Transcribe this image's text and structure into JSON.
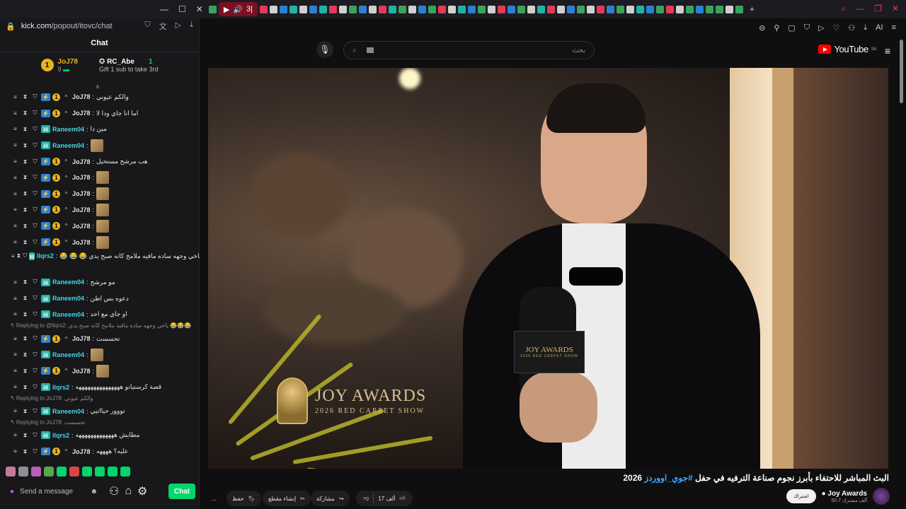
{
  "browser": {
    "audio_tab_count": "3|",
    "colors": {
      "accent": "#7a0f21",
      "chat_green": "#00d66b",
      "gold": "#e6b31e",
      "yt_red": "#ff0000"
    }
  },
  "chat": {
    "url_host": "kick.com",
    "url_path": "/popout/itovc/chat",
    "header_title": "Chat",
    "leaderboard": {
      "first": {
        "rank": "1",
        "name": "JoJ78",
        "count": "9"
      },
      "second": {
        "name": "RC_Abe",
        "count": "1",
        "note": "Gift 1 sub to take 3rd"
      }
    },
    "messages": [
      {
        "user": "JoJ78",
        "text": "والكم عيوني",
        "badges": "joj"
      },
      {
        "user": "JoJ78",
        "text": "اما انا جاي ودا لا",
        "badges": "joj"
      },
      {
        "user": "Raneem04",
        "text": "مين دا",
        "badges": "ran"
      },
      {
        "user": "Raneem04",
        "text": "",
        "badges": "ran",
        "emote": true
      },
      {
        "user": "JoJ78",
        "text": "هب مرشح مستحيل",
        "badges": "joj"
      },
      {
        "user": "JoJ78",
        "text": "",
        "badges": "joj",
        "emote": true
      },
      {
        "user": "JoJ78",
        "text": "",
        "badges": "joj",
        "emote": true
      },
      {
        "user": "JoJ78",
        "text": "",
        "badges": "joj",
        "emote": true
      },
      {
        "user": "JoJ78",
        "text": "",
        "badges": "joj",
        "emote": true
      },
      {
        "user": "JoJ78",
        "text": "",
        "badges": "joj",
        "emote": true
      },
      {
        "user": "llqrs2",
        "text": "😂 😂 😂 ياخي وجهه ساده مافيه ملامح كانه صبح يدي",
        "badges": "lla",
        "tall": true
      },
      {
        "user": "Raneem04",
        "text": "مو مرشح",
        "badges": "ran"
      },
      {
        "user": "Raneem04",
        "text": "دعوه بس اظن",
        "badges": "ran"
      },
      {
        "user": "Raneem04",
        "text": "او جاي مع احد",
        "badges": "ran"
      },
      {
        "reply": "Replying to @llqrs2: ياخي وجهه ساده مافيه ملامح كانه صبح يدي 😂😂😂"
      },
      {
        "user": "JoJ78",
        "text": "تحسست",
        "badges": "joj"
      },
      {
        "user": "Raneem04",
        "text": "",
        "badges": "ran",
        "emote": true
      },
      {
        "user": "JoJ78",
        "text": "",
        "badges": "joj",
        "emote": true
      },
      {
        "user": "llqrs2",
        "text": "قصة كرستيانو هههههههههههههههه",
        "badges": "lla"
      },
      {
        "reply": "Replying to JoJ78: والكم عيوني"
      },
      {
        "user": "Raneem04",
        "text": "تووور حيااتيي",
        "badges": "ran"
      },
      {
        "reply": "Replying to JoJ78: تحسست"
      },
      {
        "user": "llqrs2",
        "text": "مطايش هههههههههههههه",
        "badges": "lla"
      },
      {
        "user": "JoJ78",
        "text": "عليه؟ ههههه",
        "badges": "joj"
      }
    ],
    "input_placeholder": "Send a message",
    "chat_button": "Chat"
  },
  "youtube": {
    "search_placeholder": "بحث",
    "logo_text": "YouTube",
    "logo_region": "SA",
    "video_overlay": {
      "title": "JOY AWARDS",
      "subtitle": "2026 RED CARPET SHOW"
    },
    "mic_cube": {
      "title": "JOY AWARDS",
      "subtitle": "2026 RED CARPET SHOW"
    },
    "video_title_main": "البث المباشر للاحتفاء بأبرز نجوم صناعة الترفيه في حفل ",
    "video_title_tag": "#جوي_اووردز",
    "video_title_year": " 2026",
    "actions": {
      "likes": "17 ألف",
      "share": "مشاركة",
      "clip": "إنشاء مقطع",
      "save": "حفظ",
      "more": "..."
    },
    "channel": {
      "name": "Joy Awards",
      "subs": "50.7 ألف مشترك",
      "subscribe": "اشتراك"
    }
  }
}
